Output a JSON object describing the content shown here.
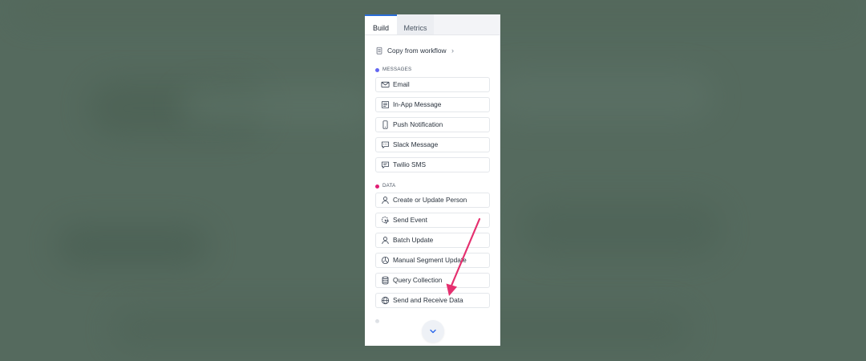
{
  "tabs": {
    "build": "Build",
    "metrics": "Metrics"
  },
  "copy_from_workflow": {
    "label": "Copy from workflow"
  },
  "sections": {
    "messages": {
      "title": "MESSAGES",
      "color": "#6366f1"
    },
    "data": {
      "title": "DATA",
      "color": "#e11d74"
    }
  },
  "messages_items": [
    {
      "label": "Email",
      "icon": "mail-icon"
    },
    {
      "label": "In-App Message",
      "icon": "message-window-icon"
    },
    {
      "label": "Push Notification",
      "icon": "phone-icon"
    },
    {
      "label": "Slack Message",
      "icon": "chat-bubble-icon"
    },
    {
      "label": "Twilio SMS",
      "icon": "sms-icon"
    }
  ],
  "data_items": [
    {
      "label": "Create or Update Person",
      "icon": "person-icon"
    },
    {
      "label": "Send Event",
      "icon": "send-event-icon"
    },
    {
      "label": "Batch Update",
      "icon": "person-icon"
    },
    {
      "label": "Manual Segment Update",
      "icon": "segment-icon"
    },
    {
      "label": "Query Collection",
      "icon": "database-icon"
    },
    {
      "label": "Send and Receive Data",
      "icon": "globe-icon"
    }
  ],
  "annotation": {
    "arrow_color": "#e5306f",
    "points_to": "Send and Receive Data"
  },
  "scroll": {
    "icon": "chevron-down-icon"
  }
}
